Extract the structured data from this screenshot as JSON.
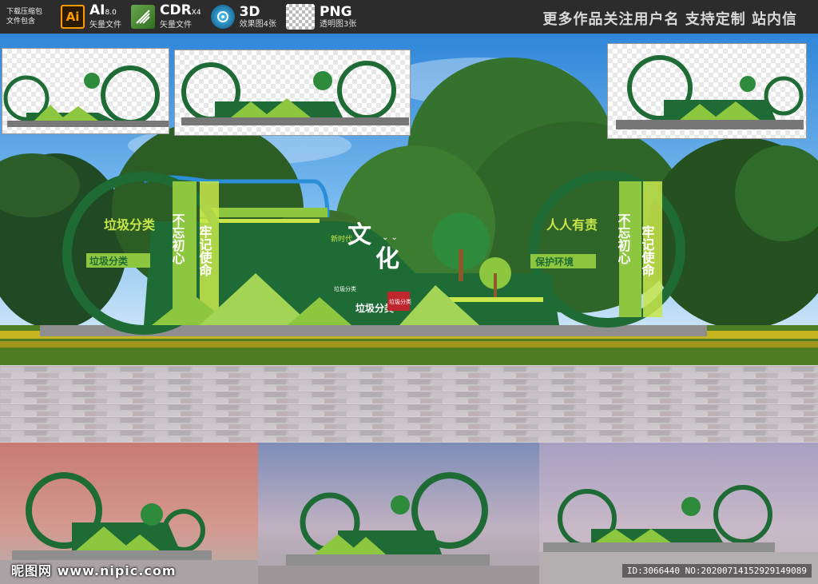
{
  "header": {
    "download_label_line1": "下载压缩包",
    "download_label_line2": "文件包含",
    "formats": [
      {
        "icon": "ai-icon",
        "icon_text": "Ai",
        "title": "AI",
        "version": "8.0",
        "sub": "矢量文件"
      },
      {
        "icon": "cdr-icon",
        "icon_text": "",
        "title": "CDR",
        "version": "X4",
        "sub": "矢量文件"
      },
      {
        "icon": "3d-icon",
        "icon_text": "",
        "title": "3D",
        "version": "",
        "sub": "效果图4张"
      },
      {
        "icon": "png-icon",
        "icon_text": "",
        "title": "PNG",
        "version": "",
        "sub": "透明图3张"
      }
    ],
    "slogan": "更多作品关注用户名 支持定制 站内信"
  },
  "sign": {
    "left_title": "垃圾分类",
    "left_subtitle": "垃圾分类",
    "left_vertical_1": "不忘初心",
    "left_vertical_2": "牢记使命",
    "center_big_1": "文",
    "center_big_2": "化",
    "center_sub": "垃圾分类",
    "center_seal": "新时代",
    "center_small": "垃圾分类",
    "right_title": "人人有责",
    "right_subtitle": "保护环境",
    "right_vertical_1": "不忘初心",
    "right_vertical_2": "牢记使命",
    "red_tag": "垃圾分类"
  },
  "footer": {
    "brand": "昵图网 www.nipic.com",
    "id_text": "ID:3066440 NO:20200714152929149089"
  },
  "colors": {
    "sign_dark_green": "#1f6b35",
    "sign_light_green": "#8dc63f",
    "sign_lime": "#c8e64a",
    "accent_blue": "#2a8fd6",
    "sky": "#4a9fe0",
    "header_bg": "#2c2c2c"
  }
}
